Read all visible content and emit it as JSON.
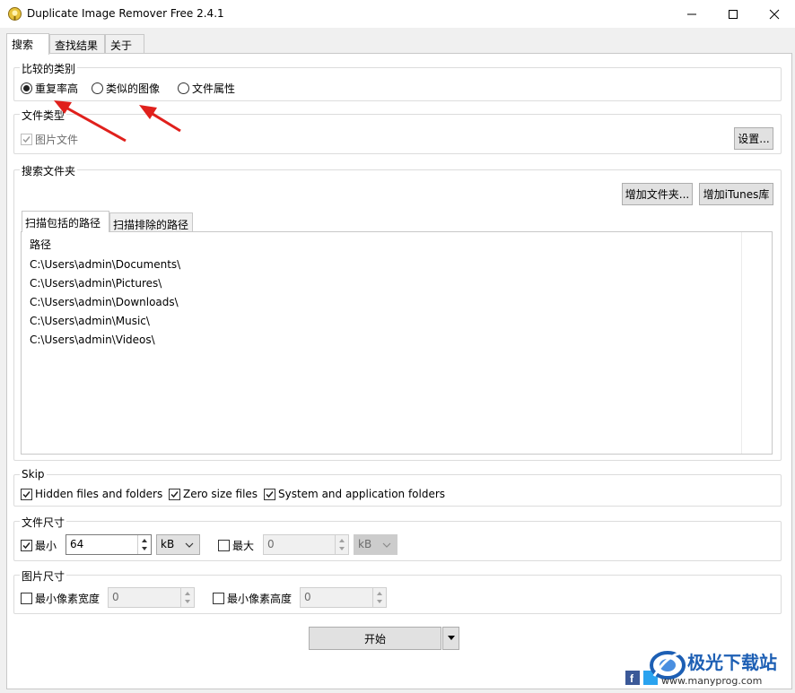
{
  "window": {
    "title": "Duplicate Image Remover Free 2.4.1"
  },
  "tabs": [
    {
      "label": "搜索",
      "active": true
    },
    {
      "label": "查找结果",
      "active": false
    },
    {
      "label": "关于",
      "active": false
    }
  ],
  "compare_type": {
    "label": "比较的类别",
    "options": [
      {
        "label": "重复率高",
        "checked": true
      },
      {
        "label": "类似的图像",
        "checked": false
      },
      {
        "label": "文件属性",
        "checked": false
      }
    ]
  },
  "file_type": {
    "label": "文件类型",
    "image_files": "图片文件",
    "settings_button": "设置..."
  },
  "search_folders": {
    "label": "搜索文件夹",
    "add_folder_button": "增加文件夹...",
    "add_itunes_button": "增加iTunes库",
    "path_tabs": [
      {
        "label": "扫描包括的路径",
        "active": true
      },
      {
        "label": "扫描排除的路径",
        "active": false
      }
    ],
    "column_header": "路径",
    "paths": [
      "C:\\Users\\admin\\Documents\\",
      "C:\\Users\\admin\\Pictures\\",
      "C:\\Users\\admin\\Downloads\\",
      "C:\\Users\\admin\\Music\\",
      "C:\\Users\\admin\\Videos\\"
    ]
  },
  "skip": {
    "label": "Skip",
    "hidden": "Hidden files and folders",
    "zero_size": "Zero size files",
    "system": "System and application folders"
  },
  "file_size": {
    "label": "文件尺寸",
    "min_label": "最小",
    "min_value": "64",
    "min_unit": "kB",
    "max_label": "最大",
    "max_value": "0",
    "max_unit": "kB"
  },
  "image_size": {
    "label": "图片尺寸",
    "min_width_label": "最小像素宽度",
    "min_width_value": "0",
    "min_height_label": "最小像素高度",
    "min_height_value": "0"
  },
  "start_button": "开始",
  "watermark": {
    "brand": "极光下载站",
    "url": "www.manyprog.com"
  },
  "colors": {
    "accent_red": "#e0201c",
    "watermark_blue": "#1d5fb4"
  }
}
